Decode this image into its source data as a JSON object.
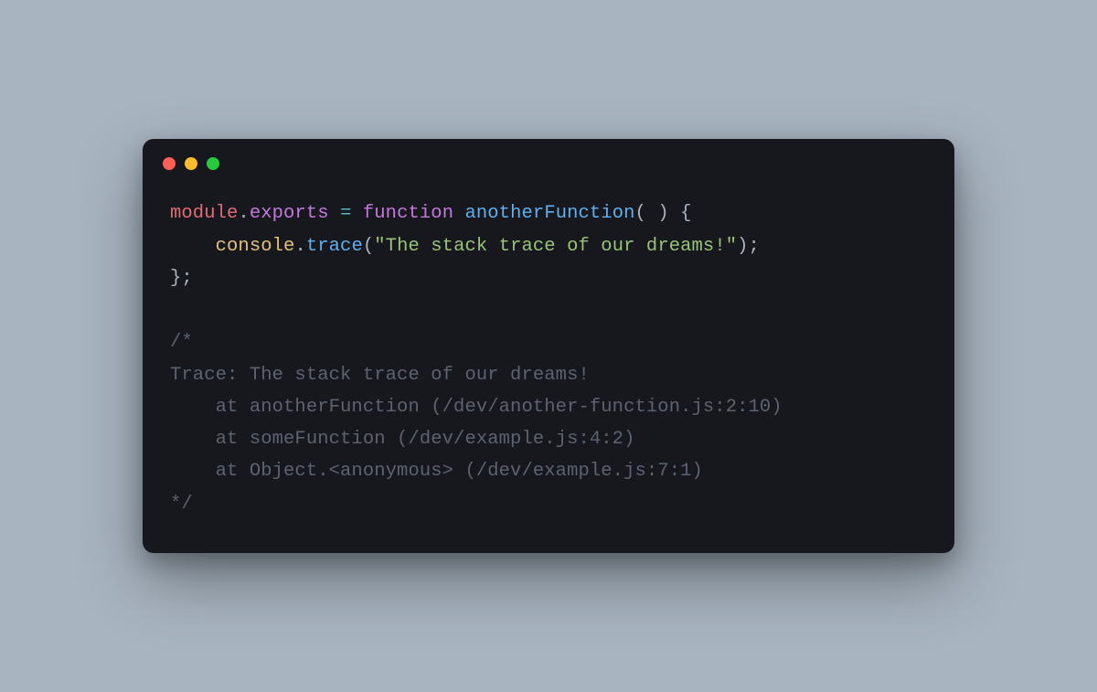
{
  "colors": {
    "dot_red": "#ff5f56",
    "dot_yellow": "#ffbd2e",
    "dot_green": "#27c93f"
  },
  "code": {
    "line1": {
      "module": "module",
      "dot1": ".",
      "exports": "exports",
      "sp1": " ",
      "eq": "=",
      "sp2": " ",
      "function_kw": "function",
      "sp3": " ",
      "fn_name": "anotherFunction",
      "parens_open": "(",
      "sp4": " ",
      "parens_close": ")",
      "sp5": " ",
      "brace_open": "{"
    },
    "line2": {
      "indent": "    ",
      "console": "console",
      "dot": ".",
      "trace": "trace",
      "paren_open": "(",
      "string": "\"The stack trace of our dreams!\"",
      "paren_close": ")",
      "semi": ";"
    },
    "line3": {
      "brace_close": "}",
      "semi": ";"
    },
    "blank": "",
    "comment": {
      "open": "/*",
      "c1": "Trace: The stack trace of our dreams!",
      "c2": "    at anotherFunction (/dev/another-function.js:2:10)",
      "c3": "    at someFunction (/dev/example.js:4:2)",
      "c4": "    at Object.<anonymous> (/dev/example.js:7:1)",
      "close": "*/"
    }
  }
}
